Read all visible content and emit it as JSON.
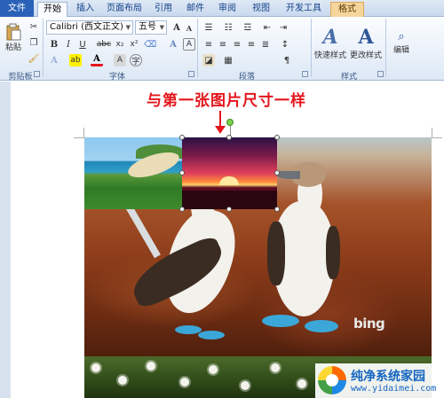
{
  "tabs": [
    {
      "label": "文件"
    },
    {
      "label": "开始"
    },
    {
      "label": "插入"
    },
    {
      "label": "页面布局"
    },
    {
      "label": "引用"
    },
    {
      "label": "邮件"
    },
    {
      "label": "审阅"
    },
    {
      "label": "视图"
    },
    {
      "label": "开发工具"
    },
    {
      "label": "格式"
    }
  ],
  "clipboard": {
    "paste_label": "粘贴",
    "group_label": "剪贴板"
  },
  "font": {
    "name": "Calibri (西文正文)",
    "size": "五号",
    "group_label": "字体"
  },
  "paragraph": {
    "group_label": "段落"
  },
  "styles": {
    "quick_label": "快速样式",
    "change_label": "更改样式",
    "group_label": "样式"
  },
  "editing": {
    "label": "编辑"
  },
  "document": {
    "caption": "与第一张图片尺寸一样",
    "watermark_brand": "bing",
    "logo_title": "纯净系统家园",
    "logo_url": "www.yidaimei.com"
  },
  "colors": {
    "accent_red": "#e4161c",
    "file_tab": "#2a62b8",
    "format_tab": "#f6d59c"
  }
}
